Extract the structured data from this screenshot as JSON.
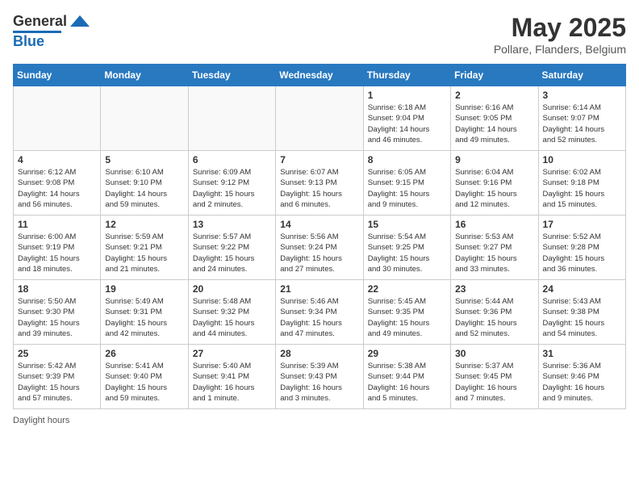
{
  "header": {
    "logo_general": "General",
    "logo_blue": "Blue",
    "title": "May 2025",
    "subtitle": "Pollare, Flanders, Belgium"
  },
  "footer": {
    "daylight_hours": "Daylight hours"
  },
  "days_of_week": [
    "Sunday",
    "Monday",
    "Tuesday",
    "Wednesday",
    "Thursday",
    "Friday",
    "Saturday"
  ],
  "weeks": [
    [
      {
        "num": "",
        "info": ""
      },
      {
        "num": "",
        "info": ""
      },
      {
        "num": "",
        "info": ""
      },
      {
        "num": "",
        "info": ""
      },
      {
        "num": "1",
        "info": "Sunrise: 6:18 AM\nSunset: 9:04 PM\nDaylight: 14 hours\nand 46 minutes."
      },
      {
        "num": "2",
        "info": "Sunrise: 6:16 AM\nSunset: 9:05 PM\nDaylight: 14 hours\nand 49 minutes."
      },
      {
        "num": "3",
        "info": "Sunrise: 6:14 AM\nSunset: 9:07 PM\nDaylight: 14 hours\nand 52 minutes."
      }
    ],
    [
      {
        "num": "4",
        "info": "Sunrise: 6:12 AM\nSunset: 9:08 PM\nDaylight: 14 hours\nand 56 minutes."
      },
      {
        "num": "5",
        "info": "Sunrise: 6:10 AM\nSunset: 9:10 PM\nDaylight: 14 hours\nand 59 minutes."
      },
      {
        "num": "6",
        "info": "Sunrise: 6:09 AM\nSunset: 9:12 PM\nDaylight: 15 hours\nand 2 minutes."
      },
      {
        "num": "7",
        "info": "Sunrise: 6:07 AM\nSunset: 9:13 PM\nDaylight: 15 hours\nand 6 minutes."
      },
      {
        "num": "8",
        "info": "Sunrise: 6:05 AM\nSunset: 9:15 PM\nDaylight: 15 hours\nand 9 minutes."
      },
      {
        "num": "9",
        "info": "Sunrise: 6:04 AM\nSunset: 9:16 PM\nDaylight: 15 hours\nand 12 minutes."
      },
      {
        "num": "10",
        "info": "Sunrise: 6:02 AM\nSunset: 9:18 PM\nDaylight: 15 hours\nand 15 minutes."
      }
    ],
    [
      {
        "num": "11",
        "info": "Sunrise: 6:00 AM\nSunset: 9:19 PM\nDaylight: 15 hours\nand 18 minutes."
      },
      {
        "num": "12",
        "info": "Sunrise: 5:59 AM\nSunset: 9:21 PM\nDaylight: 15 hours\nand 21 minutes."
      },
      {
        "num": "13",
        "info": "Sunrise: 5:57 AM\nSunset: 9:22 PM\nDaylight: 15 hours\nand 24 minutes."
      },
      {
        "num": "14",
        "info": "Sunrise: 5:56 AM\nSunset: 9:24 PM\nDaylight: 15 hours\nand 27 minutes."
      },
      {
        "num": "15",
        "info": "Sunrise: 5:54 AM\nSunset: 9:25 PM\nDaylight: 15 hours\nand 30 minutes."
      },
      {
        "num": "16",
        "info": "Sunrise: 5:53 AM\nSunset: 9:27 PM\nDaylight: 15 hours\nand 33 minutes."
      },
      {
        "num": "17",
        "info": "Sunrise: 5:52 AM\nSunset: 9:28 PM\nDaylight: 15 hours\nand 36 minutes."
      }
    ],
    [
      {
        "num": "18",
        "info": "Sunrise: 5:50 AM\nSunset: 9:30 PM\nDaylight: 15 hours\nand 39 minutes."
      },
      {
        "num": "19",
        "info": "Sunrise: 5:49 AM\nSunset: 9:31 PM\nDaylight: 15 hours\nand 42 minutes."
      },
      {
        "num": "20",
        "info": "Sunrise: 5:48 AM\nSunset: 9:32 PM\nDaylight: 15 hours\nand 44 minutes."
      },
      {
        "num": "21",
        "info": "Sunrise: 5:46 AM\nSunset: 9:34 PM\nDaylight: 15 hours\nand 47 minutes."
      },
      {
        "num": "22",
        "info": "Sunrise: 5:45 AM\nSunset: 9:35 PM\nDaylight: 15 hours\nand 49 minutes."
      },
      {
        "num": "23",
        "info": "Sunrise: 5:44 AM\nSunset: 9:36 PM\nDaylight: 15 hours\nand 52 minutes."
      },
      {
        "num": "24",
        "info": "Sunrise: 5:43 AM\nSunset: 9:38 PM\nDaylight: 15 hours\nand 54 minutes."
      }
    ],
    [
      {
        "num": "25",
        "info": "Sunrise: 5:42 AM\nSunset: 9:39 PM\nDaylight: 15 hours\nand 57 minutes."
      },
      {
        "num": "26",
        "info": "Sunrise: 5:41 AM\nSunset: 9:40 PM\nDaylight: 15 hours\nand 59 minutes."
      },
      {
        "num": "27",
        "info": "Sunrise: 5:40 AM\nSunset: 9:41 PM\nDaylight: 16 hours\nand 1 minute."
      },
      {
        "num": "28",
        "info": "Sunrise: 5:39 AM\nSunset: 9:43 PM\nDaylight: 16 hours\nand 3 minutes."
      },
      {
        "num": "29",
        "info": "Sunrise: 5:38 AM\nSunset: 9:44 PM\nDaylight: 16 hours\nand 5 minutes."
      },
      {
        "num": "30",
        "info": "Sunrise: 5:37 AM\nSunset: 9:45 PM\nDaylight: 16 hours\nand 7 minutes."
      },
      {
        "num": "31",
        "info": "Sunrise: 5:36 AM\nSunset: 9:46 PM\nDaylight: 16 hours\nand 9 minutes."
      }
    ]
  ]
}
